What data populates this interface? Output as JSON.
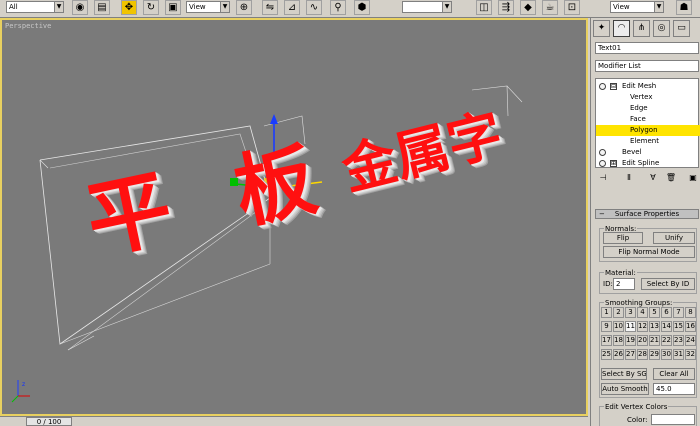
{
  "toolbar": {
    "selection_filter": "All",
    "ref_coord": "View",
    "ref_coord2": "View"
  },
  "viewport": {
    "label": "Perspective",
    "text_3d": [
      "平",
      "板",
      "金属字"
    ],
    "text_color": "#ff1010"
  },
  "timebar": {
    "slider": "0 / 100"
  },
  "panel": {
    "object_name": "Text01",
    "modifier_list": "Modifier List",
    "stack": [
      {
        "label": "Edit Mesh",
        "expand": "⊟"
      },
      {
        "label": "Vertex"
      },
      {
        "label": "Edge"
      },
      {
        "label": "Face"
      },
      {
        "label": "Polygon"
      },
      {
        "label": "Element"
      },
      {
        "label": "Bevel"
      },
      {
        "label": "Edit Spline",
        "expand": "⊞"
      }
    ],
    "surface_properties": "Surface Properties",
    "normals_label": "Normals:",
    "flip": "Flip",
    "unify": "Unify",
    "flip_normal_mode": "Flip Normal Mode",
    "material_label": "Material:",
    "id_label": "ID:",
    "id_value": "2",
    "select_by_id": "Select By ID",
    "smoothing_label": "Smoothing Groups:",
    "smoothing_groups": [
      "1",
      "2",
      "3",
      "4",
      "5",
      "6",
      "7",
      "8",
      "9",
      "10",
      "11",
      "12",
      "13",
      "14",
      "15",
      "16",
      "17",
      "18",
      "19",
      "20",
      "21",
      "22",
      "23",
      "24",
      "25",
      "26",
      "27",
      "28",
      "29",
      "30",
      "31",
      "32"
    ],
    "select_by_sg": "Select By SG",
    "clear_all": "Clear All",
    "auto_smooth": "Auto Smooth",
    "auto_smooth_value": "45.0",
    "edit_vertex_colors": "Edit Vertex Colors",
    "color_label": "Color:"
  }
}
